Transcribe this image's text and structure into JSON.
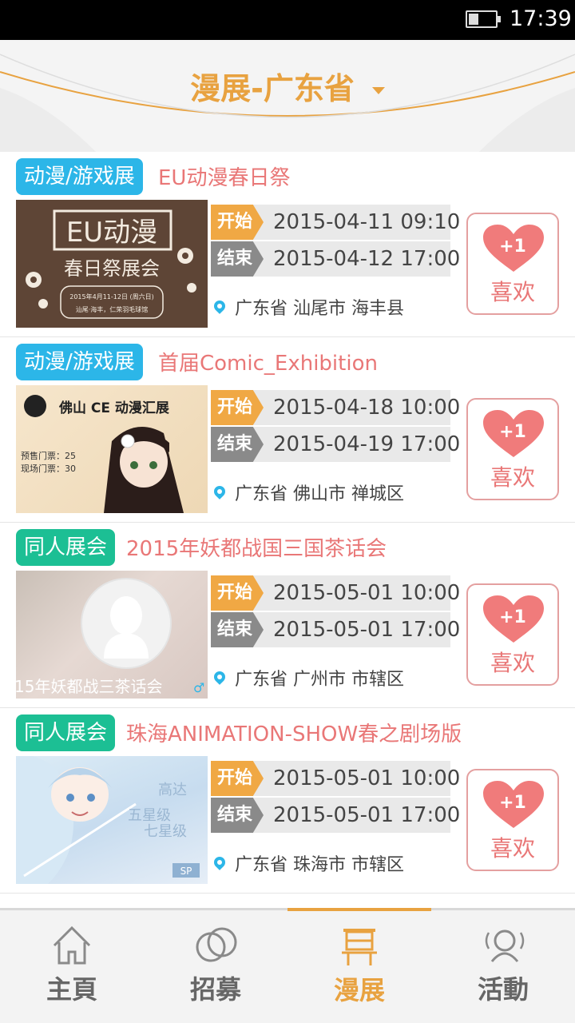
{
  "status": {
    "time": "17:39"
  },
  "header": {
    "title": "漫展-广东省"
  },
  "events": [
    {
      "category": "动漫/游戏展",
      "name": "EU动漫春日祭",
      "start_label": "开始",
      "start": "2015-04-11 09:10",
      "end_label": "结束",
      "end": "2015-04-12 17:00",
      "location": "广东省 汕尾市 海丰县",
      "like_count": "+1",
      "like_label": "喜欢",
      "poster": {
        "line1": "EU动漫",
        "line2": "春日祭展会",
        "line3": "2015年4月11-12日 (周六日)",
        "line4": "汕尾·海丰，仁荣羽毛球馆"
      }
    },
    {
      "category": "动漫/游戏展",
      "name": "首届Comic_Exhibition",
      "start_label": "开始",
      "start": "2015-04-18 10:00",
      "end_label": "结束",
      "end": "2015-04-19 17:00",
      "location": "广东省 佛山市 禅城区",
      "like_count": "+1",
      "like_label": "喜欢",
      "poster": {
        "line1": "佛山 CE 动漫汇展",
        "line2": "预售门票：25",
        "line3": "现场门票：30"
      }
    },
    {
      "category": "同人展会",
      "name": "2015年妖都战国三国茶话会",
      "start_label": "开始",
      "start": "2015-05-01 10:00",
      "end_label": "结束",
      "end": "2015-05-01 17:00",
      "location": "广东省 广州市 市辖区",
      "like_count": "+1",
      "like_label": "喜欢",
      "poster": {
        "caption": "15年妖都战三茶话会",
        "gender_symbol": "♂"
      }
    },
    {
      "category": "同人展会",
      "name": "珠海ANIMATION-SHOW春之剧场版",
      "start_label": "开始",
      "start": "2015-05-01 10:00",
      "end_label": "结束",
      "end": "2015-05-01 17:00",
      "location": "广东省 珠海市 市辖区",
      "like_count": "+1",
      "like_label": "喜欢",
      "poster": {
        "line1": "高达",
        "line2": "五星级",
        "line3": "七星级",
        "line4": "SP"
      }
    }
  ],
  "nav": [
    {
      "label": "主頁",
      "icon": "home-icon"
    },
    {
      "label": "招募",
      "icon": "rings-icon"
    },
    {
      "label": "漫展",
      "icon": "exhibition-icon",
      "active": true
    },
    {
      "label": "活動",
      "icon": "activity-icon"
    }
  ],
  "colors": {
    "accent": "#e8a240",
    "tag_blue": "#2cb6e8",
    "tag_green": "#1cbf94",
    "title_pink": "#e97777"
  }
}
